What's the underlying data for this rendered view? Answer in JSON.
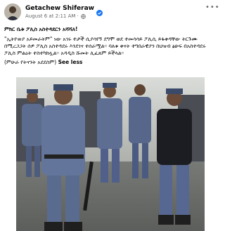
{
  "post": {
    "author_name": "Getachew Shiferaw",
    "timestamp": "August 6 at 2:11 AM",
    "headline": "ምክር ቤቱ ፖሊስ አስተዳደርን አሻሻለ!",
    "body": "\"ኢትዮጵያ አይመራትም\" ነው አገሩ ተታች ሲያሳየኝ ደግሞ ወደ ተመሳሳይ ፖሊሲ ይፋቀዳቸው ትርጉሙ በሚረጋጋት ሰዎ ፖሊስ አስተዳደሩ እንደገና ተሰራሟል፡፡ ባለቱ ቀናት ተግበራዊያን በህዝብ ፅሁፍ በአስተዳደሩ ፖሊስ ምልዕት ተስተካክሏል፡፡ አዳዲስ ሹመት ሊፈጸም ይችላል፡፡",
    "source_tag": "(ምሁራ የትናንት አደደስም)",
    "see_less": "See less",
    "more_icon": "more-options-icon",
    "verified_color": "#1877f2"
  },
  "photo": {
    "alt_subject": "uniformed police officers marching"
  }
}
